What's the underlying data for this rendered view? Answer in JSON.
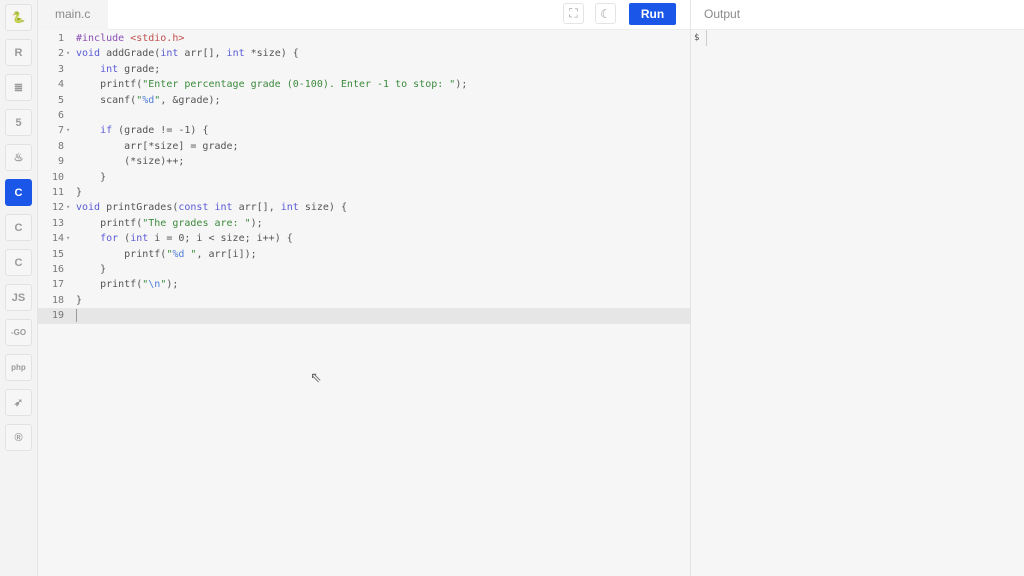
{
  "sidebar": {
    "items": [
      {
        "name": "python",
        "glyph": "🐍",
        "active": false
      },
      {
        "name": "r",
        "glyph": "R",
        "active": false
      },
      {
        "name": "sql",
        "glyph": "≣",
        "active": false
      },
      {
        "name": "html5",
        "glyph": "5",
        "active": false
      },
      {
        "name": "java",
        "glyph": "♨",
        "active": false
      },
      {
        "name": "c",
        "glyph": "C",
        "active": true
      },
      {
        "name": "cpp",
        "glyph": "C",
        "active": false
      },
      {
        "name": "csharp",
        "glyph": "C",
        "active": false
      },
      {
        "name": "javascript",
        "glyph": "JS",
        "active": false
      },
      {
        "name": "go",
        "glyph": "-GO",
        "active": false
      },
      {
        "name": "php",
        "glyph": "php",
        "active": false
      },
      {
        "name": "swift",
        "glyph": "➶",
        "active": false
      },
      {
        "name": "rust",
        "glyph": "®",
        "active": false
      }
    ]
  },
  "editor": {
    "tab": "main.c",
    "run_label": "Run",
    "lines": [
      {
        "n": "1",
        "fold": false,
        "t": [
          [
            "#include ",
            "pp"
          ],
          [
            "<stdio.h>",
            "inc"
          ]
        ]
      },
      {
        "n": "2",
        "fold": true,
        "t": [
          [
            "void",
            "kw"
          ],
          [
            " addGrade(",
            ""
          ],
          [
            "int",
            "kw"
          ],
          [
            " arr[], ",
            ""
          ],
          [
            "int",
            "kw"
          ],
          [
            " *size) {",
            ""
          ]
        ]
      },
      {
        "n": "3",
        "fold": false,
        "t": [
          [
            "    ",
            ""
          ],
          [
            "int",
            "kw"
          ],
          [
            " grade;",
            ""
          ]
        ]
      },
      {
        "n": "4",
        "fold": false,
        "t": [
          [
            "    printf(",
            ""
          ],
          [
            "\"Enter percentage grade (0-100). Enter -1 to stop: \"",
            "str"
          ],
          [
            ");",
            ""
          ]
        ]
      },
      {
        "n": "5",
        "fold": false,
        "t": [
          [
            "    scanf(",
            ""
          ],
          [
            "\"",
            "str"
          ],
          [
            "%d",
            "esc"
          ],
          [
            "\"",
            "str"
          ],
          [
            ", &grade);",
            ""
          ]
        ]
      },
      {
        "n": "6",
        "fold": false,
        "t": []
      },
      {
        "n": "7",
        "fold": true,
        "t": [
          [
            "    ",
            ""
          ],
          [
            "if",
            "kw"
          ],
          [
            " (grade != -1) {",
            ""
          ]
        ]
      },
      {
        "n": "8",
        "fold": false,
        "t": [
          [
            "        arr[*size] = grade;",
            ""
          ]
        ]
      },
      {
        "n": "9",
        "fold": false,
        "t": [
          [
            "        (*size)++;",
            ""
          ]
        ]
      },
      {
        "n": "10",
        "fold": false,
        "t": [
          [
            "    }",
            ""
          ]
        ]
      },
      {
        "n": "11",
        "fold": false,
        "t": [
          [
            "}",
            ""
          ]
        ]
      },
      {
        "n": "12",
        "fold": true,
        "t": [
          [
            "void",
            "kw"
          ],
          [
            " printGrades(",
            ""
          ],
          [
            "const",
            "kw"
          ],
          [
            " ",
            ""
          ],
          [
            "int",
            "kw"
          ],
          [
            " arr[], ",
            ""
          ],
          [
            "int",
            "kw"
          ],
          [
            " size) {",
            ""
          ]
        ]
      },
      {
        "n": "13",
        "fold": false,
        "t": [
          [
            "    printf(",
            ""
          ],
          [
            "\"The grades are: \"",
            "str"
          ],
          [
            ");",
            ""
          ]
        ]
      },
      {
        "n": "14",
        "fold": true,
        "t": [
          [
            "    ",
            ""
          ],
          [
            "for",
            "kw"
          ],
          [
            " (",
            ""
          ],
          [
            "int",
            "kw"
          ],
          [
            " i = 0; i < size; i++) {",
            ""
          ]
        ]
      },
      {
        "n": "15",
        "fold": false,
        "t": [
          [
            "        printf(",
            ""
          ],
          [
            "\"",
            "str"
          ],
          [
            "%d",
            "esc"
          ],
          [
            " \"",
            "str"
          ],
          [
            ", arr[i]);",
            ""
          ]
        ]
      },
      {
        "n": "16",
        "fold": false,
        "t": [
          [
            "    }",
            ""
          ]
        ]
      },
      {
        "n": "17",
        "fold": false,
        "t": [
          [
            "    printf(",
            ""
          ],
          [
            "\"",
            "str"
          ],
          [
            "\\n",
            "esc"
          ],
          [
            "\"",
            "str"
          ],
          [
            ");",
            ""
          ]
        ]
      },
      {
        "n": "18",
        "fold": false,
        "t": [
          [
            "}",
            ""
          ]
        ]
      },
      {
        "n": "19",
        "fold": false,
        "t": [],
        "current": true
      }
    ]
  },
  "output": {
    "title": "Output",
    "prompt": "$"
  }
}
